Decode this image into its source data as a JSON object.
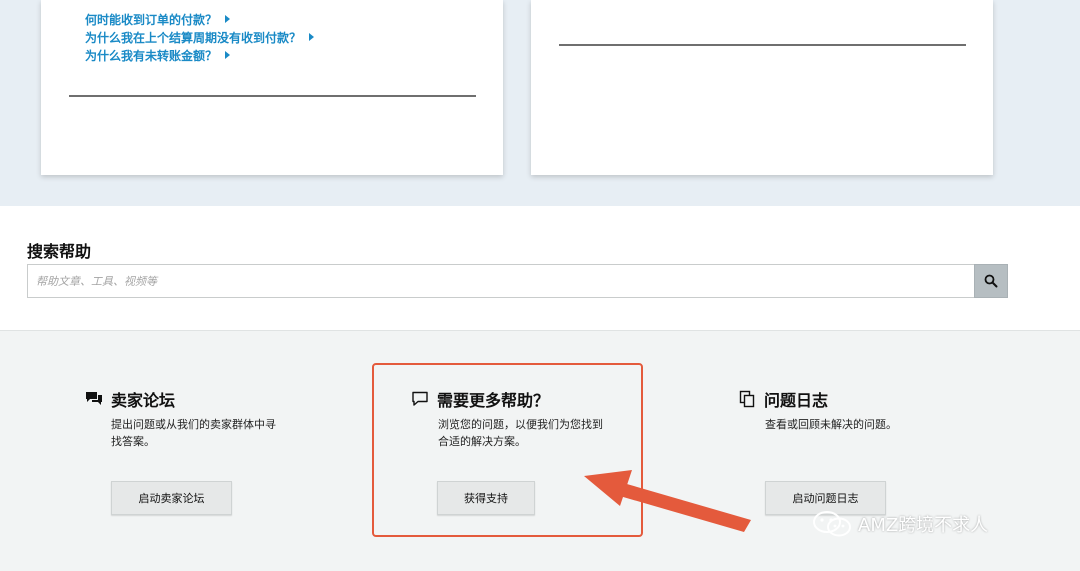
{
  "top_cards": {
    "left_links": [
      {
        "label": "何时能收到订单的付款？"
      },
      {
        "label": "为什么我在上个结算周期没有收到付款？"
      },
      {
        "label": "为什么我有未转账金额？"
      }
    ]
  },
  "search": {
    "title": "搜索帮助",
    "placeholder": "帮助文章、工具、视频等"
  },
  "help_columns": [
    {
      "title": "卖家论坛",
      "desc_line1": "提出问题或从我们的卖家群体中寻",
      "desc_line2": "找答案。",
      "button": "启动卖家论坛"
    },
    {
      "title": "需要更多帮助？",
      "desc_line1": "浏览您的问题，以便我们为您找到",
      "desc_line2": "合适的解决方案。",
      "button": "获得支持"
    },
    {
      "title": "问题日志",
      "desc_line1": "查看或回顾未解决的问题。",
      "button": "启动问题日志"
    }
  ],
  "annotation": {
    "highlight_color": "#e45a3c"
  },
  "watermark": {
    "text": "AMZ跨境不求人"
  },
  "colors": {
    "link_blue": "#1a8ac6",
    "top_band": "#e7eef4",
    "bottom_band": "#f2f4f4"
  }
}
